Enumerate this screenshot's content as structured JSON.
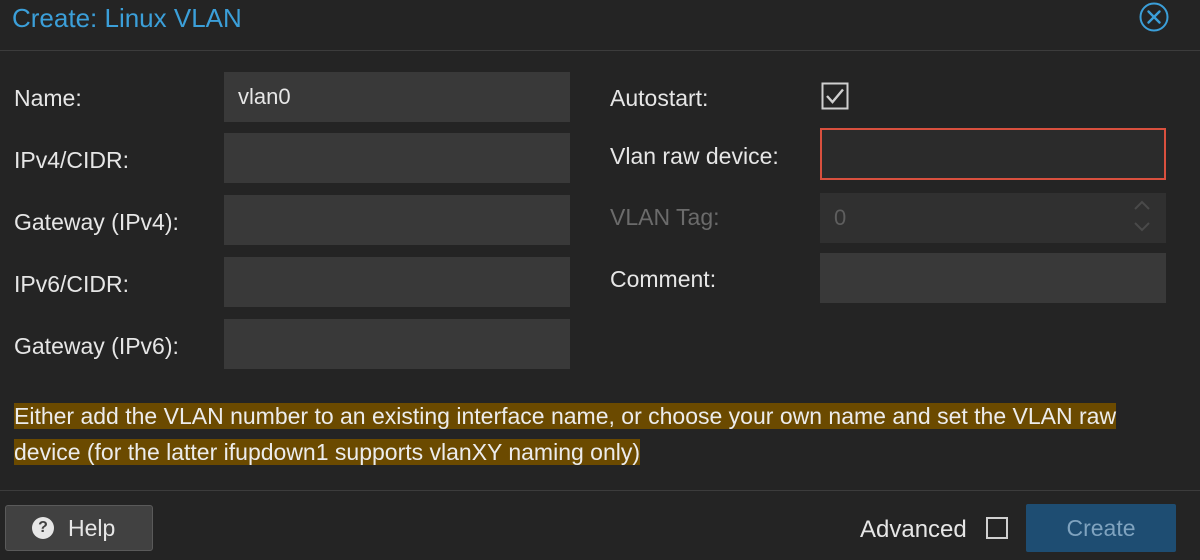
{
  "dialog": {
    "title": "Create: Linux VLAN"
  },
  "form": {
    "name": {
      "label": "Name:",
      "value": "vlan0"
    },
    "ipv4": {
      "label": "IPv4/CIDR:",
      "value": ""
    },
    "gateway4": {
      "label": "Gateway (IPv4):",
      "value": ""
    },
    "ipv6": {
      "label": "IPv6/CIDR:",
      "value": ""
    },
    "gateway6": {
      "label": "Gateway (IPv6):",
      "value": ""
    },
    "autostart": {
      "label": "Autostart:",
      "checked": true
    },
    "raw_device": {
      "label": "Vlan raw device:",
      "value": ""
    },
    "vlan_tag": {
      "label": "VLAN Tag:",
      "value": "0",
      "disabled": true
    },
    "comment": {
      "label": "Comment:",
      "value": ""
    }
  },
  "info": {
    "text": "Either add the VLAN number to an existing interface name, or choose your own name and set the VLAN raw device (for the latter ifupdown1 supports vlanXY naming only)"
  },
  "footer": {
    "help_label": "Help",
    "advanced_label": "Advanced",
    "advanced_checked": false,
    "create_label": "Create"
  },
  "colors": {
    "accent": "#3b9fd9",
    "invalid_border": "#d9503e",
    "info_background": "#6b4a00",
    "primary_button": "#1e4d72"
  }
}
